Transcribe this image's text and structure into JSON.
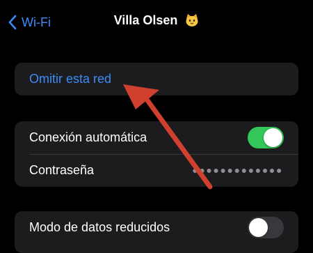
{
  "nav": {
    "back_label": "Wi-Fi",
    "title": "Villa Olsen",
    "title_emoji": "cat-face-icon"
  },
  "forget_group": {
    "forget_label": "Omitir esta red"
  },
  "connection_group": {
    "auto_join_label": "Conexión automática",
    "auto_join_on": true,
    "password_label": "Contraseña",
    "password_value": "●●●●●●●●●●●●●"
  },
  "data_group": {
    "low_data_label": "Modo de datos reducidos",
    "low_data_on": false
  },
  "colors": {
    "accent": "#3b8df6",
    "toggle_on": "#34c759",
    "annotation_arrow": "#d0402f"
  }
}
